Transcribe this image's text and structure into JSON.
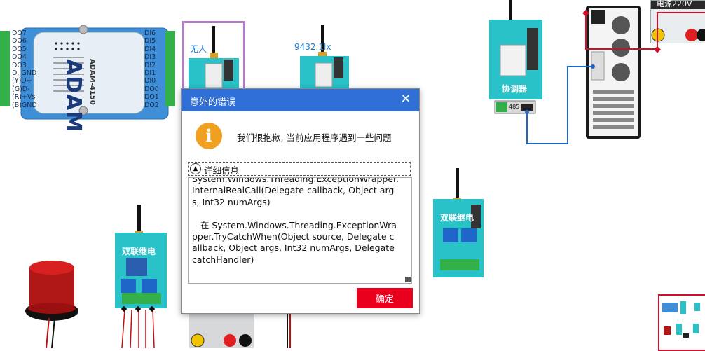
{
  "adam": {
    "brand": "ADAM",
    "model": "ADAM-4150",
    "left_pins": [
      "DO7",
      "DO6",
      "DO5",
      "DO4",
      "DO3",
      "D. GND",
      "(Y)D+",
      "(G)D-",
      "(R)+Vs",
      "(B)GND"
    ],
    "right_pins": [
      "DI6",
      "DI5",
      "DI4",
      "DI3",
      "DI2",
      "DI1",
      "DI0",
      "DO0",
      "DO1",
      "DO2"
    ]
  },
  "devices": {
    "node1_label": "无人",
    "node2_label": "9432.1lx",
    "coordinator_label": "协调器",
    "coordinator_port": "485",
    "relay_label": "双联继电",
    "relay2_label": "双联继电"
  },
  "power": {
    "label": "电源220V"
  },
  "modal": {
    "title": "意外的错误",
    "message": "我们很抱歉, 当前应用程序遇到一些问题",
    "details_label": "详细信息",
    "details_text": "System.Windows.Threading.ExceptionWrapper.InternalRealCall(Delegate callback, Object args, Int32 numArgs)\n\n   在 System.Windows.Threading.ExceptionWrapper.TryCatchWhen(Object source, Delegate callback, Object args, Int32 numArgs, Delegate catchHandler)",
    "ok_label": "确定"
  },
  "colors": {
    "accent": "#2f6fd6",
    "ok_button": "#e8001c",
    "device_teal": "#29c2c8",
    "adam_blue": "#3f8fd8",
    "terminal_green": "#34b04a"
  }
}
